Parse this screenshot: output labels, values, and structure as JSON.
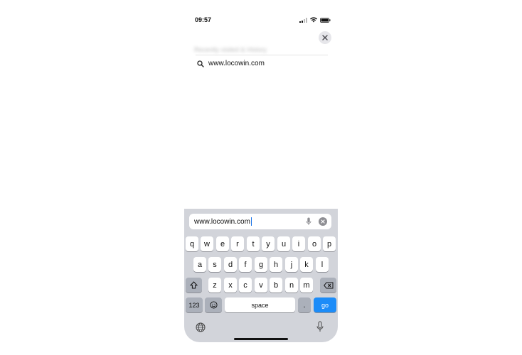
{
  "status_bar": {
    "time": "09:57"
  },
  "suggestions": {
    "blurred_text": "Recently visited & History",
    "items": [
      {
        "label": "www.locowin.com",
        "icon": "search-icon"
      }
    ]
  },
  "url_bar": {
    "value": "www.locowin.com"
  },
  "keyboard": {
    "row1": [
      "q",
      "w",
      "e",
      "r",
      "t",
      "y",
      "u",
      "i",
      "o",
      "p"
    ],
    "row2": [
      "a",
      "s",
      "d",
      "f",
      "g",
      "h",
      "j",
      "k",
      "l"
    ],
    "row3": [
      "z",
      "x",
      "c",
      "v",
      "b",
      "n",
      "m"
    ],
    "numbers_key": "123",
    "space_key": "space",
    "period_key": ".",
    "go_key": "go"
  },
  "colors": {
    "go": "#1c8cf8",
    "keyboard_bg": "#d2d4da",
    "caret": "#1a73e8"
  }
}
